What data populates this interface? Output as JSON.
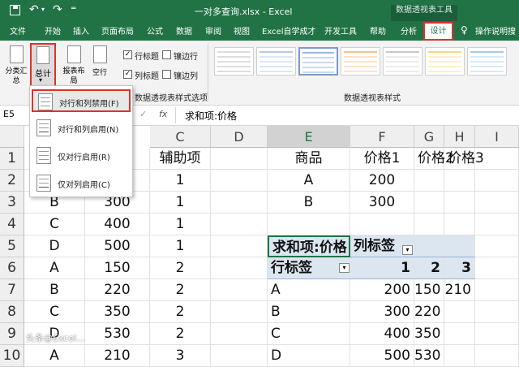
{
  "title_bar": {
    "file_title": "一对多查询.xlsx",
    "separator": "-",
    "app_name": "Excel",
    "context_tool": "数据透视表工具"
  },
  "ribbon_tabs": [
    "文件",
    "开始",
    "插入",
    "页面布局",
    "公式",
    "数据",
    "审阅",
    "视图",
    "Excel自学成才",
    "开发工具",
    "帮助",
    "分析",
    "设计"
  ],
  "tell_me": "操作说明搜",
  "ribbon": {
    "subtotal_label": "分类汇总",
    "grand_total_label": "总计",
    "report_layout_label": "报表布局",
    "blank_rows_label": "空行",
    "options": {
      "row_headers": "行标题",
      "banded_rows": "镶边行",
      "column_headers": "列标题",
      "banded_columns": "镶边列"
    },
    "options_group_label": "数据透视表样式选项",
    "styles_group_label": "数据透视表样式"
  },
  "formula_bar": {
    "name_box": "E5",
    "fx": "fx",
    "formula": "求和项:价格"
  },
  "grand_total_menu": [
    "对行和列禁用(F)",
    "对行和列启用(N)",
    "仅对行启用(R)",
    "仅对列启用(C)"
  ],
  "columns": [
    "C",
    "D",
    "E",
    "F",
    "G",
    "H",
    "I"
  ],
  "rows": [
    "1",
    "2",
    "3",
    "4",
    "5",
    "6",
    "7",
    "8",
    "9",
    "10"
  ],
  "cells": {
    "B4": "C",
    "B5": "D",
    "B6": "A",
    "B7": "B",
    "B8": "C",
    "B9": "D",
    "B10": "A",
    "B3": "B",
    "C_col_b": [
      "",
      "",
      "300",
      "400",
      "500",
      "150",
      "220",
      "350",
      "530",
      "210"
    ],
    "D1": "辅助项",
    "D_values": [
      "1",
      "1",
      "1",
      "1",
      "2",
      "2",
      "2",
      "2",
      "3"
    ],
    "E1": "商品",
    "E2": "A",
    "E3": "B",
    "F1": "价格1",
    "F2": "200",
    "F3": "300",
    "G1": "价格2",
    "H1": "价格3"
  },
  "pivot": {
    "sum_label": "求和项:价格",
    "col_labels": "列标签",
    "row_labels": "行标签",
    "col_keys": [
      "1",
      "2",
      "3"
    ],
    "rows": [
      {
        "key": "A",
        "v": [
          "200",
          "150",
          "210"
        ]
      },
      {
        "key": "B",
        "v": [
          "300",
          "220",
          ""
        ]
      },
      {
        "key": "C",
        "v": [
          "400",
          "350",
          ""
        ]
      },
      {
        "key": "D",
        "v": [
          "500",
          "530",
          ""
        ]
      }
    ]
  },
  "watermark": "头条@Excel...",
  "colors": {
    "excel_green": "#217346",
    "highlight_red": "#d9342b",
    "pivot_header": "#dce6f1"
  }
}
